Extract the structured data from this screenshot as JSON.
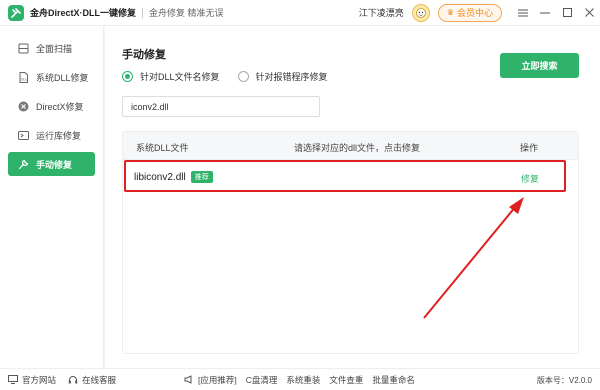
{
  "titlebar": {
    "app_title": "金舟DirectX·DLL一键修复",
    "subtitle": "金舟修复 精准无误",
    "username": "江下凌漂亮",
    "member_label": "会员中心",
    "icons": {
      "logo": "tools-logo-icon",
      "avatar": "user-avatar-icon",
      "crown": "crown-icon",
      "menu": "menu-icon",
      "minimize": "minimize-icon",
      "maximize": "maximize-icon",
      "close": "close-icon"
    }
  },
  "sidebar": {
    "items": [
      {
        "label": "全面扫描",
        "icon": "scan-icon",
        "active": false
      },
      {
        "label": "系统DLL修复",
        "icon": "dll-file-icon",
        "active": false
      },
      {
        "label": "DirectX修复",
        "icon": "directx-icon",
        "active": false
      },
      {
        "label": "运行库修复",
        "icon": "runtime-library-icon",
        "active": false
      },
      {
        "label": "手动修复",
        "icon": "wrench-icon",
        "active": true
      }
    ]
  },
  "main": {
    "title": "手动修复",
    "radio_options": [
      {
        "label": "针对DLL文件名修复",
        "checked": true
      },
      {
        "label": "针对报错程序修复",
        "checked": false
      }
    ],
    "search_value": "iconv2.dll",
    "search_button": "立即搜索",
    "table": {
      "headers": {
        "name": "系统DLL文件",
        "desc": "请选择对应的dll文件，点击修复",
        "op": "操作"
      },
      "rows": [
        {
          "name": "libiconv2.dll",
          "badge": "推荐",
          "action": "修复"
        }
      ]
    }
  },
  "statusbar": {
    "website": "官方网站",
    "support": "在线客服",
    "recommend": "[应用推荐]",
    "links": [
      "C盘清理",
      "系统重装",
      "文件查重",
      "批量重命名"
    ],
    "version": "版本号：V2.0.0"
  },
  "colors": {
    "accent": "#2fb36b",
    "highlight": "#e02020",
    "member": "#f08a1c"
  }
}
